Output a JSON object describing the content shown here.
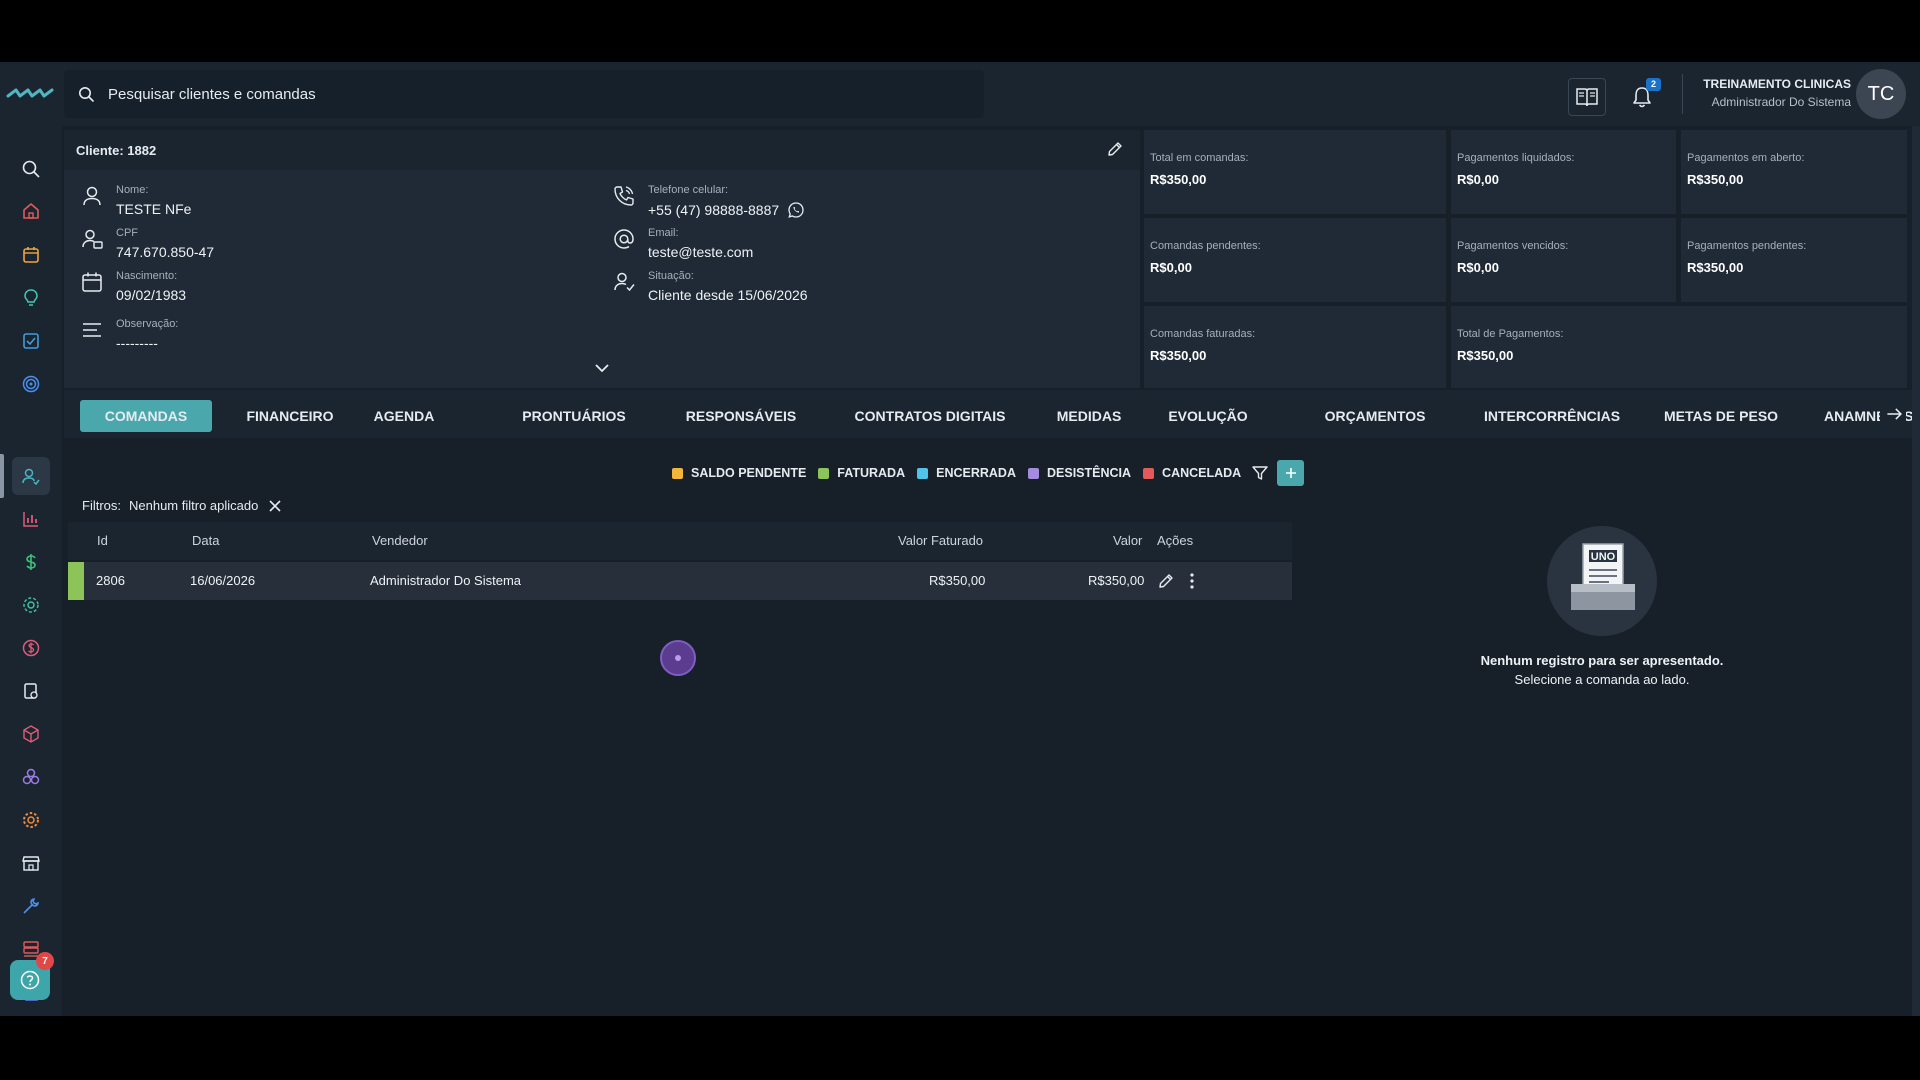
{
  "search": {
    "placeholder": "Pesquisar clientes e comandas"
  },
  "header": {
    "notifications_count": "2",
    "user_name": "TREINAMENTO CLINICAS",
    "user_role": "Administrador Do Sistema",
    "avatar_initials": "TC"
  },
  "sidebar": {
    "icons": [
      "search-icon",
      "home-icon",
      "calendar-icon",
      "lightbulb-icon",
      "checklist-icon",
      "target-icon",
      "clients-icon",
      "chart-icon",
      "dollar-icon",
      "gear-badge-icon",
      "coin-icon",
      "box-transfer-icon",
      "package-icon",
      "cubes-icon",
      "settings-icon",
      "store-icon",
      "tools-icon",
      "server-icon",
      "document-icon"
    ],
    "help_badge": "7"
  },
  "client": {
    "title": "Cliente: 1882",
    "name_label": "Nome:",
    "name": "TESTE NFe",
    "cpf_label": "CPF",
    "cpf": "747.670.850-47",
    "birth_label": "Nascimento:",
    "birth": "09/02/1983",
    "obs_label": "Observação:",
    "obs": "---------",
    "phone_label": "Telefone celular:",
    "phone": "+55 (47) 98888-8887",
    "email_label": "Email:",
    "email": "teste@teste.com",
    "status_label": "Situação:",
    "status": "Cliente desde 15/06/2026"
  },
  "stats": [
    {
      "label": "Total em comandas:",
      "value": "R$350,00"
    },
    {
      "label": "Pagamentos liquidados:",
      "value": "R$0,00"
    },
    {
      "label": "Pagamentos em aberto:",
      "value": "R$350,00"
    },
    {
      "label": "Comandas pendentes:",
      "value": "R$0,00"
    },
    {
      "label": "Pagamentos vencidos:",
      "value": "R$0,00"
    },
    {
      "label": "Pagamentos pendentes:",
      "value": "R$350,00"
    },
    {
      "label": "Comandas faturadas:",
      "value": "R$350,00"
    },
    {
      "label": "Total de Pagamentos:",
      "value": "R$350,00"
    }
  ],
  "tabs": [
    "COMANDAS",
    "FINANCEIRO",
    "AGENDA",
    "PRONTUÁRIOS",
    "RESPONSÁVEIS",
    "CONTRATOS DIGITAIS",
    "MEDIDAS",
    "EVOLUÇÃO",
    "ORÇAMENTOS",
    "INTERCORRÊNCIAS",
    "METAS DE PESO",
    "ANAMNESES"
  ],
  "legend": [
    {
      "label": "SALDO PENDENTE",
      "color": "#f2b63a"
    },
    {
      "label": "FATURADA",
      "color": "#8cc45a"
    },
    {
      "label": "ENCERRADA",
      "color": "#4fc3e8"
    },
    {
      "label": "DESISTÊNCIA",
      "color": "#a48be0"
    },
    {
      "label": "CANCELADA",
      "color": "#e25a5a"
    }
  ],
  "filters": {
    "label": "Filtros:",
    "value": "Nenhum filtro aplicado"
  },
  "table": {
    "headers": [
      "Id",
      "Data",
      "Vendedor",
      "Valor Faturado",
      "Valor",
      "Ações"
    ],
    "rows": [
      {
        "id": "2806",
        "date": "16/06/2026",
        "seller": "Administrador Do Sistema",
        "billed": "R$350,00",
        "value": "R$350,00"
      }
    ]
  },
  "empty": {
    "illustration_text": "UNO",
    "title": "Nenhum registro para ser apresentado.",
    "subtitle": "Selecione a comanda ao lado."
  }
}
